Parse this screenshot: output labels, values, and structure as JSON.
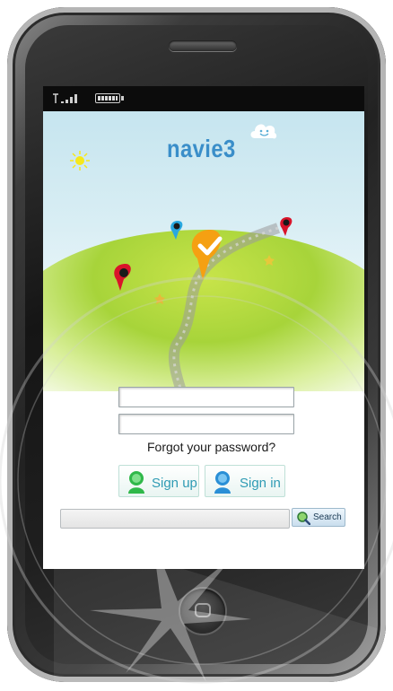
{
  "app": {
    "logo_text": "navie3",
    "username_value": "",
    "password_value": "",
    "forgot_password": "Forgot your password?",
    "signup_label": "Sign up",
    "signin_label": "Sign in",
    "search_value": "",
    "search_button": "Search"
  },
  "icons": {
    "status": [
      "signal-icon",
      "battery-icon"
    ],
    "decor": [
      "sun-icon",
      "cloud-face-icon",
      "map-pin-icon",
      "checkmark-pin-icon",
      "person-icon",
      "magnify-icon"
    ]
  },
  "colors": {
    "logo": "#3a8ec9",
    "button_text": "#2e9bb4",
    "pin_red": "#d9142a",
    "pin_blue": "#29a8e0",
    "pin_orange": "#f5a012",
    "hill_green": "#a7d43a"
  }
}
